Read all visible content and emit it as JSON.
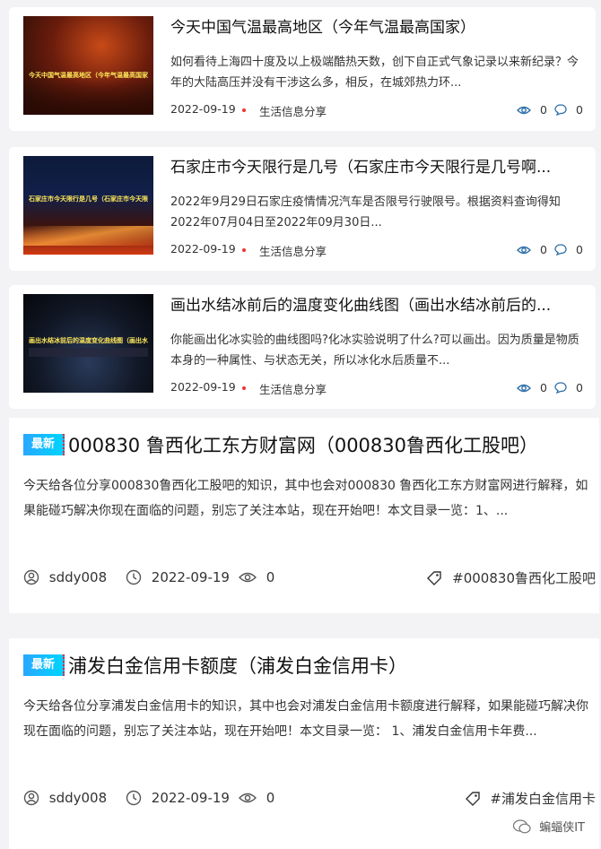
{
  "small_cards": [
    {
      "title": "今天中国气温最高地区（今年气温最高国家）",
      "thumb_caption": "今天中国气温最高地区（今年气温最高国家）",
      "desc": "如何看待上海四十度及以上极端酷热天数，创下自正式气象记录以来新纪录？今年的大陆高压并没有干涉这么多，相反，在城郊热力环...",
      "date": "2022-09-19",
      "category": "生活信息分享",
      "views": "0",
      "comments": "0"
    },
    {
      "title": "石家庄市今天限行是几号（石家庄市今天限行是几号啊...",
      "thumb_caption": "石家庄市今天限行是几号（石家庄市今天限行是几号啊）",
      "desc": "2022年9月29日石家庄疫情情况汽车是否限号行驶限号。根据资料查询得知2022年07月04日至2022年09月30日...",
      "date": "2022-09-19",
      "category": "生活信息分享",
      "views": "0",
      "comments": "0"
    },
    {
      "title": "画出水结冰前后的温度变化曲线图（画出水结冰前后的...",
      "thumb_caption": "画出水结冰前后的温度变化曲线图（画出水结冰前后的温度变化曲线图）",
      "desc": "你能画出化冰实验的曲线图吗?化冰实验说明了什么?可以画出。因为质量是物质本身的一种属性、与状态无关，所以冰化水后质量不...",
      "date": "2022-09-19",
      "category": "生活信息分享",
      "views": "0",
      "comments": "0"
    }
  ],
  "big_posts": [
    {
      "badge": "最新",
      "title": "000830 鲁西化工东方财富网（000830鲁西化工股吧）",
      "desc": "今天给各位分享000830鲁西化工股吧的知识，其中也会对000830 鲁西化工东方财富网进行解释，如果能碰巧解决你现在面临的问题，别忘了关注本站，现在开始吧！本文目录一览：1、...",
      "author": "sddy008",
      "date": "2022-09-19",
      "views": "0",
      "tag": "#000830鲁西化工股吧"
    },
    {
      "badge": "最新",
      "title": "浦发白金信用卡额度（浦发白金信用卡）",
      "desc": "今天给各位分享浦发白金信用卡的知识，其中也会对浦发白金信用卡额度进行解释，如果能碰巧解决你现在面临的问题，别忘了关注本站，现在开始吧！本文目录一览： 1、浦发白金信用卡年费...",
      "author": "sddy008",
      "date": "2022-09-19",
      "views": "0",
      "tag": "#浦发白金信用卡"
    }
  ],
  "watermark": "蝙蝠侠IT",
  "colors": {
    "badge_start": "#29a8ff",
    "badge_end": "#00d4ff",
    "dot": "#e33",
    "meta_icon": "#2f6fa8"
  }
}
